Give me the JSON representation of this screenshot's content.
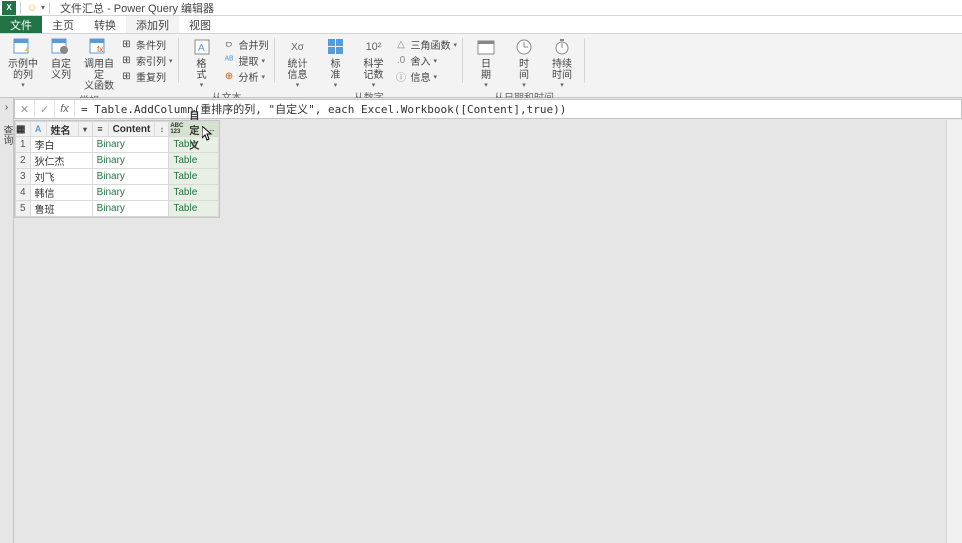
{
  "title": "文件汇总 - Power Query 编辑器",
  "app_initial": "X",
  "tabs": {
    "file": "文件",
    "home": "主页",
    "transform": "转换",
    "add_col": "添加列",
    "view": "视图"
  },
  "ribbon": {
    "group1": {
      "label": "常规",
      "btn_example": "示例中\n的列",
      "btn_custom": "自定\n义列",
      "btn_invoke": "调用自定\n义函数",
      "small_cond": "条件列",
      "small_index": "索引列",
      "small_dup": "重复列"
    },
    "group2": {
      "label": "从文本",
      "btn_format": "格\n式",
      "small_merge": "合并列",
      "small_extract": "提取",
      "small_parse": "分析"
    },
    "group3": {
      "label": "从数字",
      "btn_stat": "统计\n信息",
      "btn_std": "标\n准",
      "btn_sci": "科学\n记数",
      "small_trig": "三角函数",
      "small_round": "舍入",
      "small_info": "信息"
    },
    "group4": {
      "label": "从日期和时间",
      "btn_date": "日\n期",
      "btn_time": "时\n间",
      "btn_dur": "持续\n时间"
    }
  },
  "formula": "= Table.AddColumn(重排序的列, \"自定义\", each Excel.Workbook([Content],true))",
  "side_label": "查询",
  "columns": {
    "c1": "姓名",
    "c2": "Content",
    "c3": "自定义"
  },
  "type_icons": {
    "c1": "A",
    "c2": "≡",
    "c3": "ABC\n123"
  },
  "rows": [
    {
      "n": "1",
      "name": "李白",
      "content": "Binary",
      "custom": "Table"
    },
    {
      "n": "2",
      "name": "狄仁杰",
      "content": "Binary",
      "custom": "Table"
    },
    {
      "n": "3",
      "name": "刘飞",
      "content": "Binary",
      "custom": "Table"
    },
    {
      "n": "4",
      "name": "韩信",
      "content": "Binary",
      "custom": "Table"
    },
    {
      "n": "5",
      "name": "鲁班",
      "content": "Binary",
      "custom": "Table"
    }
  ]
}
